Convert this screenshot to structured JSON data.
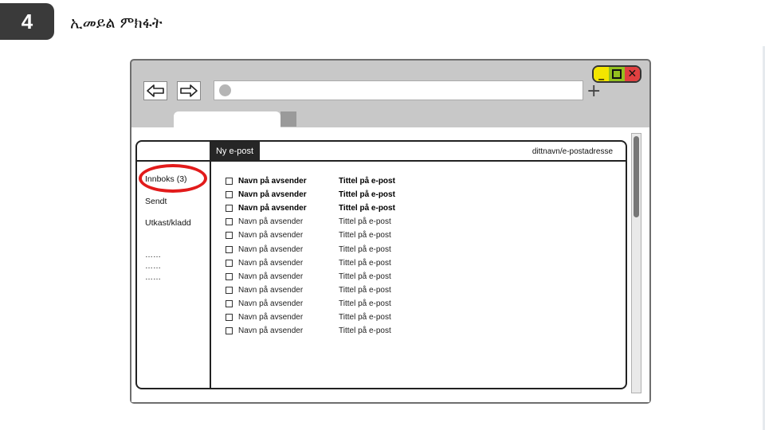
{
  "slide": {
    "step_number": "4",
    "title": "ኢመይል ምክፋት"
  },
  "browser": {
    "controls": {
      "minimize": "_",
      "close": "✕"
    },
    "new_tab": "+"
  },
  "mail": {
    "compose_label": "Ny e-post",
    "user_address": "dittnavn/e-postadresse",
    "folders": {
      "inbox": "Innboks (3)",
      "sent": "Sendt",
      "drafts": "Utkast/kladd",
      "more": [
        "……",
        "……",
        "……"
      ]
    },
    "messages": [
      {
        "sender": "Navn på avsender",
        "subject": "Tittel på e-post",
        "unread": true
      },
      {
        "sender": "Navn på avsender",
        "subject": "Tittel på e-post",
        "unread": true
      },
      {
        "sender": "Navn på avsender",
        "subject": "Tittel på e-post",
        "unread": true
      },
      {
        "sender": "Navn på avsender",
        "subject": "Tittel på e-post",
        "unread": false
      },
      {
        "sender": "Navn på avsender",
        "subject": "Tittel på e-post",
        "unread": false
      },
      {
        "sender": "Navn på avsender",
        "subject": "Tittel på e-post",
        "unread": false
      },
      {
        "sender": "Navn på avsender",
        "subject": "Tittel på e-post",
        "unread": false
      },
      {
        "sender": "Navn på avsender",
        "subject": "Tittel på e-post",
        "unread": false
      },
      {
        "sender": "Navn på avsender",
        "subject": "Tittel på e-post",
        "unread": false
      },
      {
        "sender": "Navn på avsender",
        "subject": "Tittel på e-post",
        "unread": false
      },
      {
        "sender": "Navn på avsender",
        "subject": "Tittel på e-post",
        "unread": false
      },
      {
        "sender": "Navn på avsender",
        "subject": "Tittel på e-post",
        "unread": false
      }
    ]
  },
  "colors": {
    "badge": "#3a3a3a",
    "highlight": "#e21b1b",
    "minimize": "#f3e600",
    "maximize": "#93c01f",
    "close": "#e04040"
  }
}
